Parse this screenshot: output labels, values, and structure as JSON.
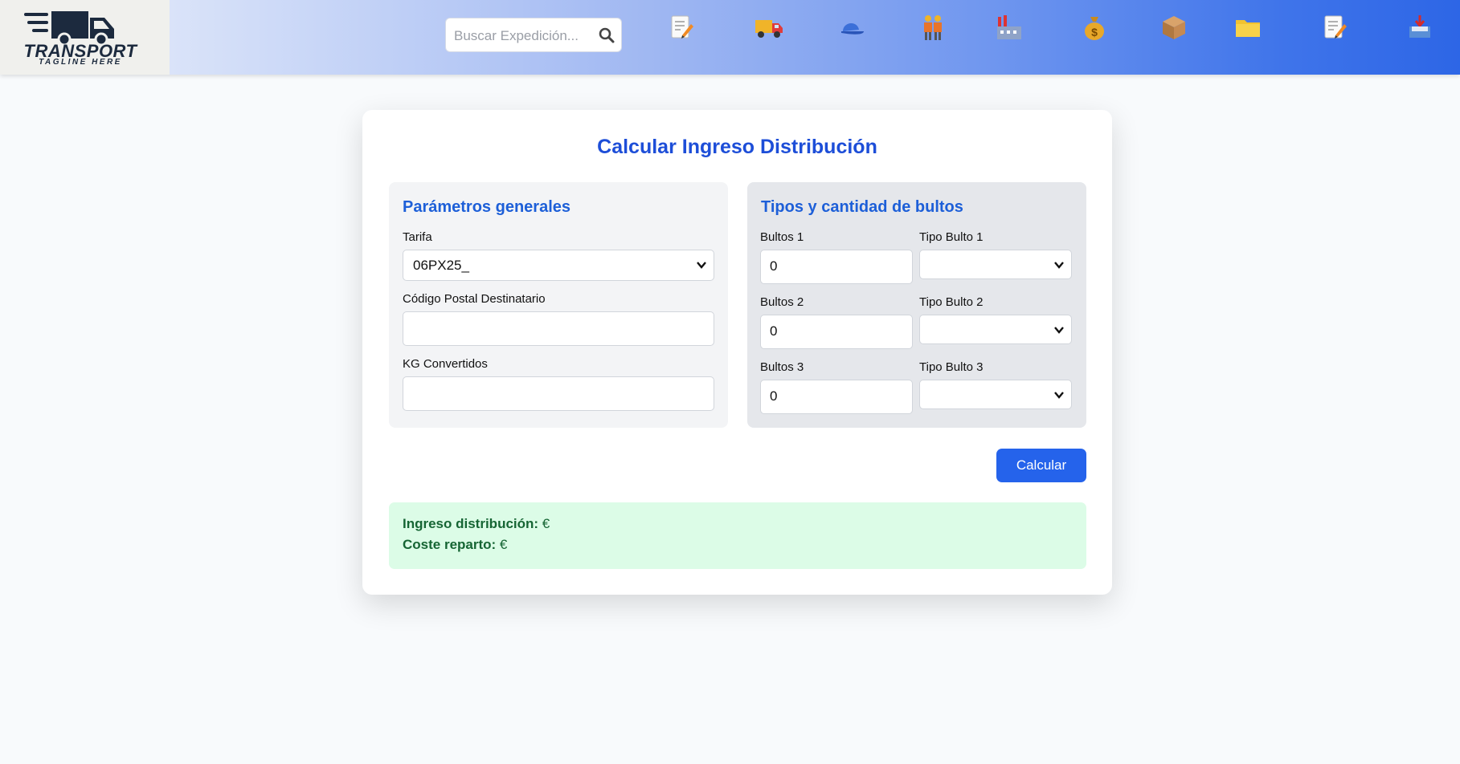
{
  "brand": {
    "name": "TRANSPORT",
    "tagline": "TAGLINE HERE"
  },
  "search": {
    "placeholder": "Buscar Expedición..."
  },
  "nav": {
    "icons": [
      "memo-icon",
      "delivery-truck-icon",
      "cap-icon",
      "workers-icon",
      "factory-icon",
      "money-bag-icon",
      "package-icon",
      "folder-icon",
      "memo-icon",
      "inbox-tray-icon"
    ]
  },
  "form": {
    "title": "Calcular Ingreso Distribución",
    "general": {
      "title": "Parámetros generales",
      "tarifa_label": "Tarifa",
      "tarifa_value": "06PX25_",
      "cp_label": "Código Postal Destinatario",
      "cp_value": "",
      "kg_label": "KG Convertidos",
      "kg_value": ""
    },
    "bultos": {
      "title": "Tipos y cantidad de bultos",
      "rows": [
        {
          "count_label": "Bultos 1",
          "count_value": "0",
          "type_label": "Tipo Bulto 1",
          "type_value": ""
        },
        {
          "count_label": "Bultos 2",
          "count_value": "0",
          "type_label": "Tipo Bulto 2",
          "type_value": ""
        },
        {
          "count_label": "Bultos 3",
          "count_value": "0",
          "type_label": "Tipo Bulto 3",
          "type_value": ""
        }
      ]
    },
    "calc_button": "Calcular"
  },
  "result": {
    "ingreso_label": "Ingreso distribución:",
    "ingreso_value": "€",
    "coste_label": "Coste reparto:",
    "coste_value": "€"
  },
  "colors": {
    "accent": "#1d4ed8",
    "button": "#2563eb",
    "result_bg": "#dcfce7",
    "result_text": "#166534"
  }
}
